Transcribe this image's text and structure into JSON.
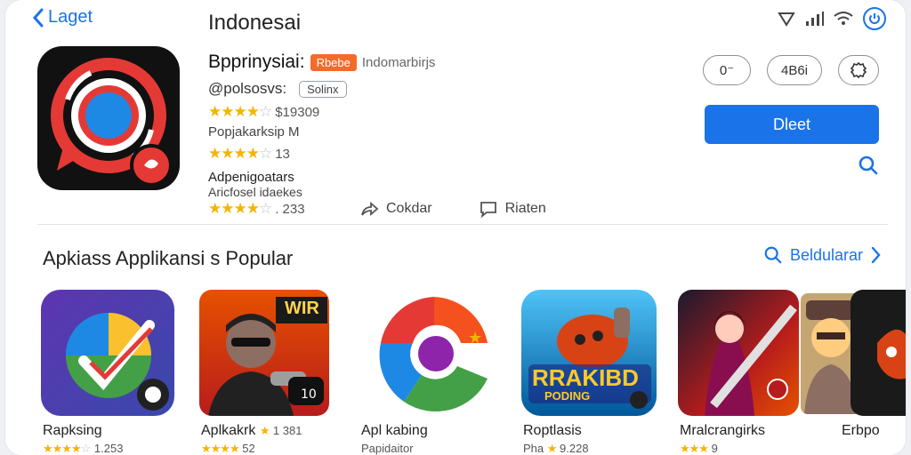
{
  "nav": {
    "back_label": "Laget",
    "title": "Indonesai"
  },
  "app": {
    "name": "Bpprinysiai:",
    "badge": "Rbebe",
    "developer": "Indomarbirjs",
    "handle": "@polsosvs:",
    "chip": "Solinx",
    "rating1": {
      "stars": 4,
      "text": "$19309"
    },
    "publisher": "Popjakarksip M",
    "rating2": {
      "stars": 4,
      "text": "13"
    },
    "adv_line1": "Adpenigoatars",
    "adv_line2": "Aricfosel idaekes",
    "rating3": {
      "stars": 4,
      "text": ". 233"
    },
    "share_label": "Cokdar",
    "review_label": "Riaten"
  },
  "actions": {
    "pill1": "0⁻",
    "pill2": "4B6i",
    "primary": "Dleet"
  },
  "section": {
    "title": "Apkiass Applikansi s Popular",
    "see_all": "Beldularar"
  },
  "apps": [
    {
      "name": "Rapksing",
      "stars": 4,
      "meta": "1.253"
    },
    {
      "name": "Aplkakrk",
      "stars": 4,
      "meta": "1 381",
      "sub": "52"
    },
    {
      "name": "Apl kabing",
      "stars": 0,
      "meta": "",
      "sub": "Papidaitor"
    },
    {
      "name": "Roptlasis",
      "stars": 1,
      "meta": "9.228",
      "prefix": "Pha"
    },
    {
      "name": "Mralcrangirks",
      "stars": 3,
      "meta": "9"
    },
    {
      "name": "Erbpo",
      "stars": 0,
      "meta": ""
    }
  ],
  "tile_texts": {
    "tile2": "WIR",
    "tile4_main": "RRAKIBD",
    "tile4_sub": "PODING"
  },
  "colors": {
    "accent": "#1a73e8",
    "star": "#f4b400",
    "badge": "#f26b2a"
  }
}
